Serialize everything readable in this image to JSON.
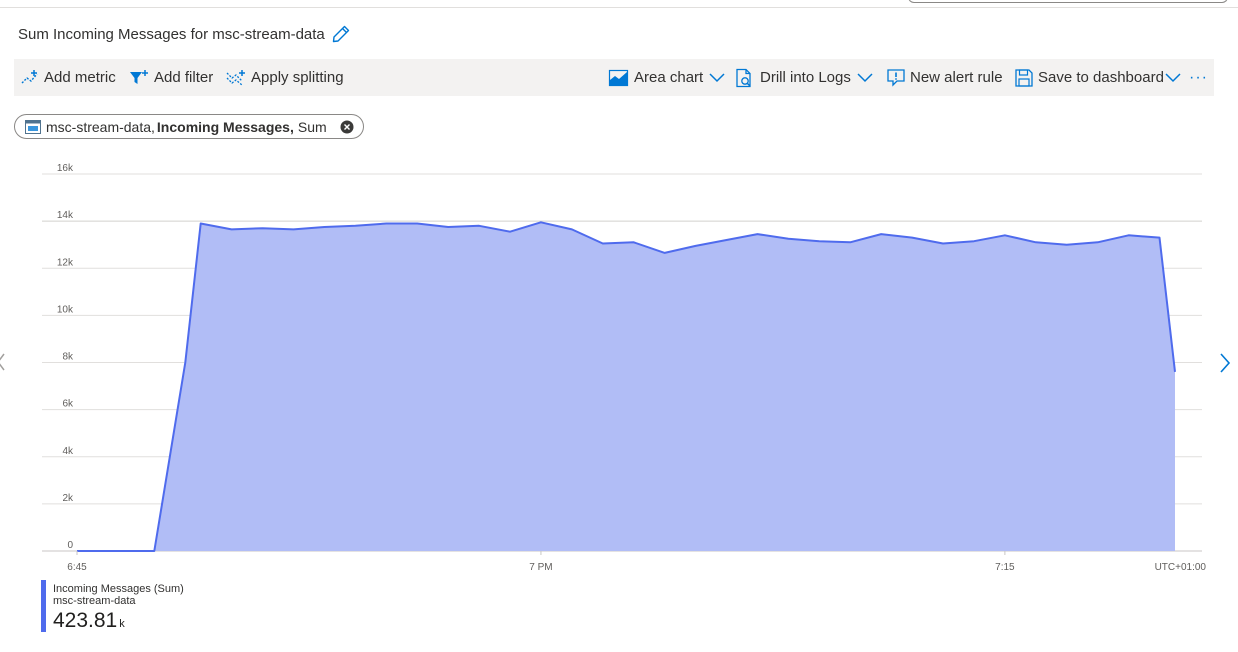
{
  "header": {
    "title": "Sum Incoming Messages for msc-stream-data"
  },
  "toolbar": {
    "add_metric": "Add metric",
    "add_filter": "Add filter",
    "apply_splitting": "Apply splitting",
    "chart_type": "Area chart",
    "drill_into_logs": "Drill into Logs",
    "new_alert_rule": "New alert rule",
    "save_to_dashboard": "Save to dashboard",
    "more": "···"
  },
  "metric_pill": {
    "resource": "msc-stream-data,",
    "metric": "Incoming Messages,",
    "aggregation": "Sum"
  },
  "colors": {
    "series_line": "#4f6bed",
    "series_fill": "#b1bdf6",
    "accent": "#0078d4"
  },
  "chart_data": {
    "type": "area",
    "ylim": [
      0,
      16000
    ],
    "y_ticks": [
      "0",
      "2k",
      "4k",
      "6k",
      "8k",
      "10k",
      "12k",
      "14k",
      "16k"
    ],
    "x_tick_labels": [
      {
        "t": 0,
        "label": "6:45"
      },
      {
        "t": 15,
        "label": "7 PM"
      },
      {
        "t": 30,
        "label": "7:15"
      }
    ],
    "timezone_label": "UTC+01:00",
    "x_range_minutes": [
      0,
      35.5
    ],
    "series": [
      {
        "name": "Incoming Messages (Sum)",
        "minutes": [
          0,
          1,
          2,
          2.5,
          3,
          3.5,
          4,
          5,
          6,
          7,
          8,
          9,
          10,
          11,
          12,
          13,
          14,
          15,
          16,
          17,
          18,
          19,
          20,
          21,
          22,
          23,
          24,
          25,
          26,
          27,
          28,
          29,
          30,
          31,
          32,
          33,
          34,
          35,
          35.5
        ],
        "values": [
          0,
          0,
          0,
          0,
          4000,
          8000,
          13900,
          13650,
          13700,
          13650,
          13750,
          13800,
          13900,
          13900,
          13750,
          13800,
          13550,
          13950,
          13650,
          13050,
          13100,
          12650,
          12950,
          13200,
          13450,
          13250,
          13150,
          13100,
          13450,
          13300,
          13050,
          13150,
          13400,
          13100,
          13000,
          13100,
          13400,
          13300,
          7600
        ]
      }
    ]
  },
  "legend": {
    "name": "Incoming Messages (Sum)",
    "resource": "msc-stream-data",
    "value": "423.81",
    "unit": "k"
  }
}
